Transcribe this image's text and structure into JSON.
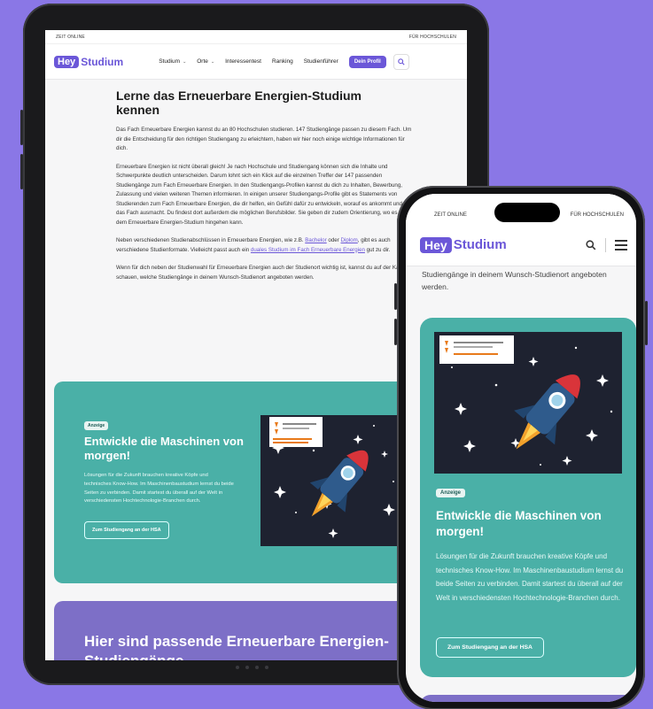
{
  "tablet": {
    "topbar": {
      "left": "ZEIT ONLINE",
      "right": "FÜR HOCHSCHULEN"
    },
    "logo": {
      "hey": "Hey",
      "studium": "Studium"
    },
    "menu": [
      {
        "label": "Studium",
        "has_dropdown": true
      },
      {
        "label": "Orte",
        "has_dropdown": true
      },
      {
        "label": "Interessentest",
        "has_dropdown": false
      },
      {
        "label": "Ranking",
        "has_dropdown": false
      },
      {
        "label": "Studienführer",
        "has_dropdown": false
      }
    ],
    "profile_button": "Dein Profil",
    "article": {
      "title": "Lerne das Erneuerbare Energien-Studium kennen",
      "p1": "Das Fach Erneuerbare Energien kannst du an 80 Hochschulen studieren. 147 Studiengänge passen zu diesem Fach. Um dir die Entscheidung für den richtigen Studiengang zu erleichtern, haben wir hier noch einige wichtige Informationen für dich.",
      "p2": "Erneuerbare Energien ist nicht überall gleich! Je nach Hochschule und Studiengang können sich die Inhalte und Schwerpunkte deutlich unterscheiden. Darum lohnt sich ein Klick auf die einzelnen Treffer der 147 passenden Studiengänge zum Fach Erneuerbare Energien. In den Studiengangs-Profilen kannst du dich zu Inhalten, Bewerbung, Zulassung und vielen weiteren Themen informieren. In einigen unserer Studiengangs-Profile gibt es Statements von Studierenden zum Fach Erneuerbare Energien, die dir helfen, ein Gefühl dafür zu entwickeln, worauf es ankommt und was das Fach ausmacht. Du findest dort außerdem die möglichen Berufsbilder. Sie geben dir zudem Orientierung, wo es nach dem Erneuerbare Energien-Studium hingehen kann.",
      "p3_a": "Neben verschiedenen Studienabschlüssen in Erneuerbare Energien, wie z.B. ",
      "p3_link1": "Bachelor",
      "p3_b": " oder ",
      "p3_link2": "Diplom",
      "p3_c": ", gibt es auch verschiedene Studienformate. Vielleicht passt auch ein ",
      "p3_link3": "duales Studium im Fach Erneuerbare Energien",
      "p3_d": " gut zu dir.",
      "p4": "Wenn für dich neben der Studienwahl für Erneuerbare Energien auch der Studienort wichtig ist, kannst du auf der Karte schauen, welche Studiengänge in deinem Wunsch-Studienort angeboten werden."
    },
    "ad": {
      "badge": "Anzeige",
      "title": "Entwickle die Maschinen von morgen!",
      "text": "Lösungen für die Zukunft brauchen kreative Köpfe und technisches Know-How. Im Maschinenbaustudium lernst du beide Seiten zu verbinden. Damit startest du überall auf der Welt in verschiedensten Hochtechnologie-Branchen durch.",
      "button": "Zum Studiengang an der HSA"
    },
    "next_section_title": "Hier sind passende Erneuerbare Energien-Studiengänge"
  },
  "phone": {
    "topbar": {
      "left": "ZEIT ONLINE",
      "right": "FÜR HOCHSCHULEN"
    },
    "logo": {
      "hey": "Hey",
      "studium": "Studium"
    },
    "partial_text": "Studiengänge in deinem Wunsch-Studienort angeboten werden.",
    "ad": {
      "badge": "Anzeige",
      "title": "Entwickle die Maschinen von morgen!",
      "text": "Lösungen für die Zukunft brauchen kreative Köpfe und technisches Know-How. Im Maschinenbaustudium lernst du beide Seiten zu verbinden. Damit startest du überall auf der Welt in verschiedensten Hochtechnologie-Branchen durch.",
      "button": "Zum Studiengang an der HSA"
    }
  },
  "colors": {
    "background": "#8a77e6",
    "brand": "#6b57d8",
    "ad_teal": "#4ab0a7",
    "purple_section": "#7d6fc7",
    "rocket_red": "#d9343a",
    "rocket_body": "#2f5b8c"
  },
  "icons": [
    "search-icon",
    "menu-icon",
    "chevron-down-icon",
    "rocket-illustration"
  ]
}
